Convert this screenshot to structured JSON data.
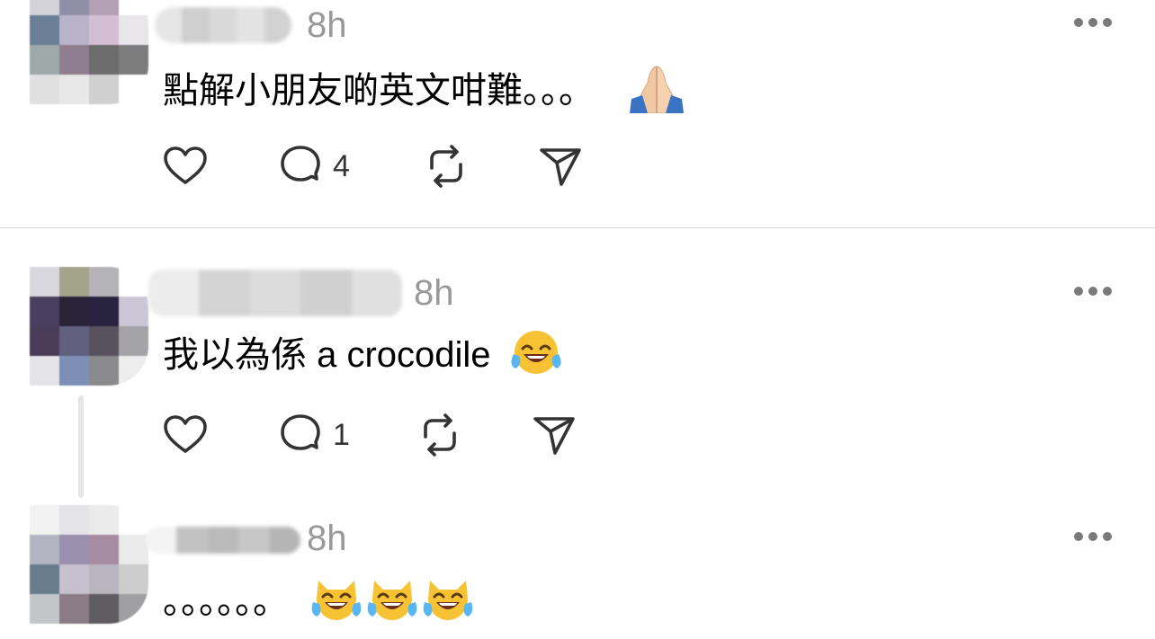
{
  "posts": [
    {
      "time": "8h",
      "text": "點解小朋友啲英文咁難。。。",
      "emojis": [
        "folded-hands"
      ],
      "replies": "4",
      "colors": {
        "avatar": [
          "#d4d3da",
          "#908fa8",
          "#b3a0b5",
          "#ffffff",
          "#6a7e96",
          "#b8b3c8",
          "#d3bed3",
          "#e8e6ea",
          "#9ea8a8",
          "#8e7e90",
          "#6c6c6c",
          "#7d7d7d",
          "#e0e0e0",
          "#e8e8e8",
          "#d0d0d0",
          "#ffffff"
        ],
        "name": [
          "#e6e6e6",
          "#cfcfcf",
          "#d9d9d9",
          "#e3e3e3",
          "#d2d2d2"
        ]
      }
    },
    {
      "time": "8h",
      "text": "我以為係 a crocodile",
      "emojis": [
        "face-with-tears-of-joy"
      ],
      "replies": "1",
      "colors": {
        "avatar": [
          "#d9d8e0",
          "#a4a48a",
          "#b4b3b8",
          "#ffffff",
          "#4a3f5e",
          "#2a2338",
          "#282440",
          "#cac6d6",
          "#4b3d59",
          "#61607e",
          "#57525e",
          "#a3a3a8",
          "#e4e4e8",
          "#7d8fb5",
          "#8a8a8c",
          "#ededed"
        ],
        "name": [
          "#ececec",
          "#d4d4d4",
          "#dcdcdc",
          "#d0d0d0",
          "#e0e0e0"
        ]
      }
    },
    {
      "time": "8h",
      "text": "。。。。。。",
      "emojis": [
        "grinning-cat-with-tears",
        "grinning-cat-with-tears",
        "grinning-cat-with-tears"
      ],
      "colors": {
        "avatar": [
          "#f2f2f2",
          "#e4e4e8",
          "#ebebeb",
          "#ffffff",
          "#b4b5c3",
          "#9b8fae",
          "#a78ba0",
          "#eaeaea",
          "#687c8c",
          "#c6c0cf",
          "#b8b4c0",
          "#cccccc",
          "#c3c6c9",
          "#8b7b87",
          "#5f5d61",
          "#a0a0a2"
        ],
        "name": [
          "#f4f4f4",
          "#c2c2c2",
          "#bababa",
          "#c6c6c6",
          "#b5b5b5"
        ]
      }
    }
  ]
}
